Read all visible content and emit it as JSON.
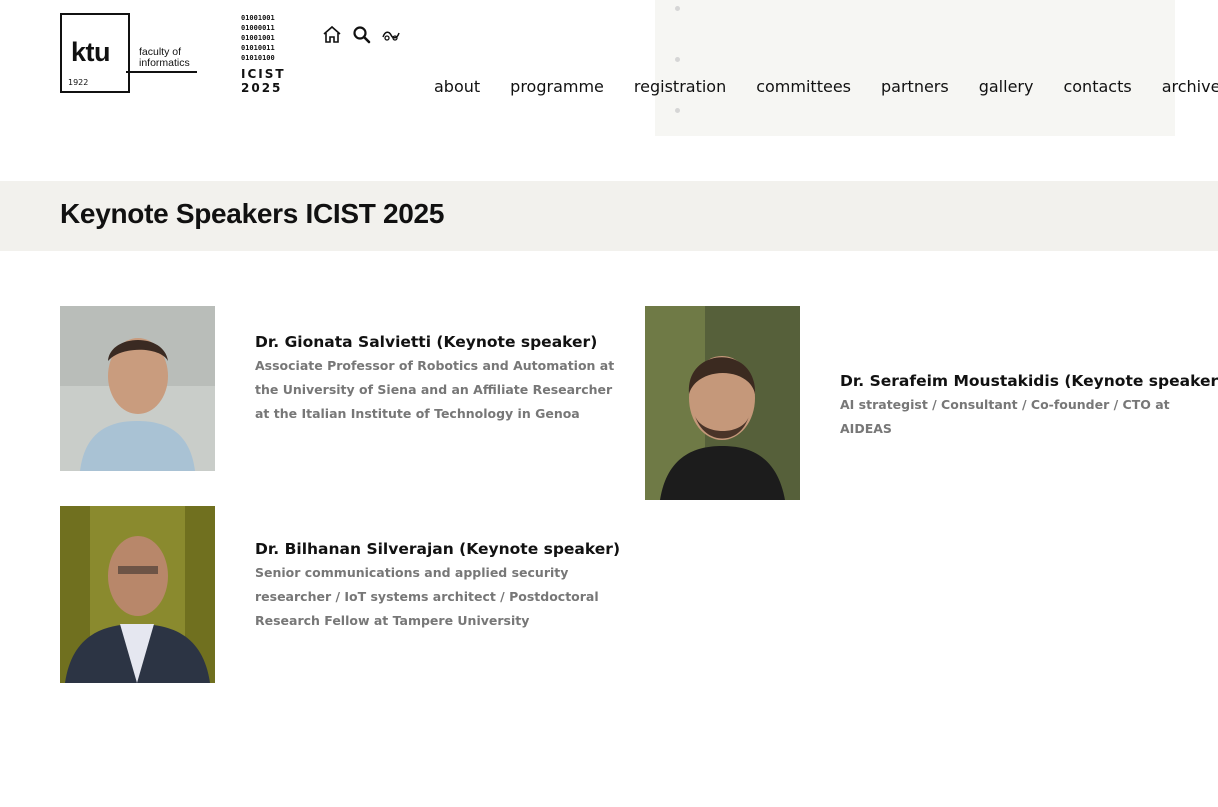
{
  "logo": {
    "ktu": "ktu",
    "year": "1922",
    "faculty_line1": "faculty of",
    "faculty_line2": "informatics",
    "binary": [
      "01001001",
      "01000011",
      "01001001",
      "01010011",
      "01010100"
    ],
    "conference_line1": "ICIST",
    "conference_line2": "2025"
  },
  "header_icons": [
    "home-icon",
    "search-icon",
    "accessibility-icon"
  ],
  "nav": [
    {
      "label": "about"
    },
    {
      "label": "programme"
    },
    {
      "label": "registration"
    },
    {
      "label": "committees"
    },
    {
      "label": "partners"
    },
    {
      "label": "gallery"
    },
    {
      "label": "contacts"
    },
    {
      "label": "archive"
    }
  ],
  "page_title": "Keynote Speakers ICIST 2025",
  "speakers": [
    {
      "name": "Dr. Gionata Salvietti (Keynote speaker)",
      "description": "Associate Professor of Robotics and Automation at the University of Siena and an Affiliate Researcher at the Italian Institute of Technology in Genoa"
    },
    {
      "name": "Dr. Serafeim Moustakidis (Keynote speaker)",
      "description": "AI strategist / Consultant / Co-founder / CTO at AIDEAS"
    },
    {
      "name": "Dr. Bilhanan Silverajan (Keynote speaker)",
      "description": "Senior communications and applied security researcher / IoT systems architect / Postdoctoral Research Fellow at Tampere University"
    }
  ],
  "colors": {
    "band_background": "#f2f1ed",
    "text": "#111111",
    "description_text": "#777777"
  }
}
